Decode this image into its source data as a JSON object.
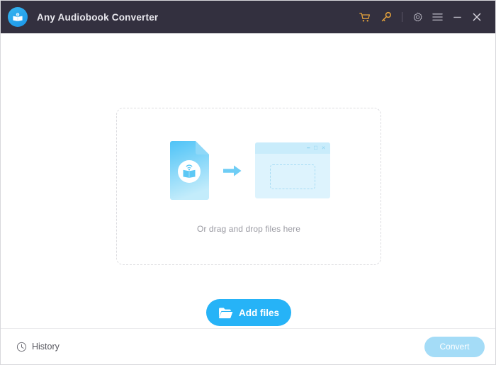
{
  "window": {
    "title": "Any Audiobook Converter",
    "logo_icon": "audiobook-logo-icon",
    "titlebar_bg": "#33303f",
    "accent": "#26b3f7",
    "icon_orange": "#e3a13c"
  },
  "titlebar_actions": [
    {
      "name": "cart-icon",
      "label": "Buy / Cart",
      "color": "#e3a13c"
    },
    {
      "name": "key-icon",
      "label": "Register / License Key",
      "color": "#e3a13c"
    },
    {
      "name": "gear-icon",
      "label": "Settings",
      "color": "#b6b4c0"
    },
    {
      "name": "hamburger-menu-icon",
      "label": "Menu",
      "color": "#b6b4c0"
    },
    {
      "name": "minimize-icon",
      "label": "Minimize",
      "color": "#b6b4c0"
    },
    {
      "name": "close-icon",
      "label": "Close",
      "color": "#d6d4dd"
    }
  ],
  "dropzone": {
    "hint_text": "Or drag and drop files here",
    "document_icon": "audiobook-file-icon",
    "arrow_icon": "arrow-right-icon",
    "window_preview_icon": "target-window-icon",
    "window_controls": [
      "minimize",
      "maximize",
      "close"
    ]
  },
  "main": {
    "add_files_label": "Add files",
    "add_files_icon": "folder-open-icon"
  },
  "bottombar": {
    "history_label": "History",
    "history_icon": "clock-icon",
    "convert_label": "Convert",
    "convert_enabled": false
  }
}
